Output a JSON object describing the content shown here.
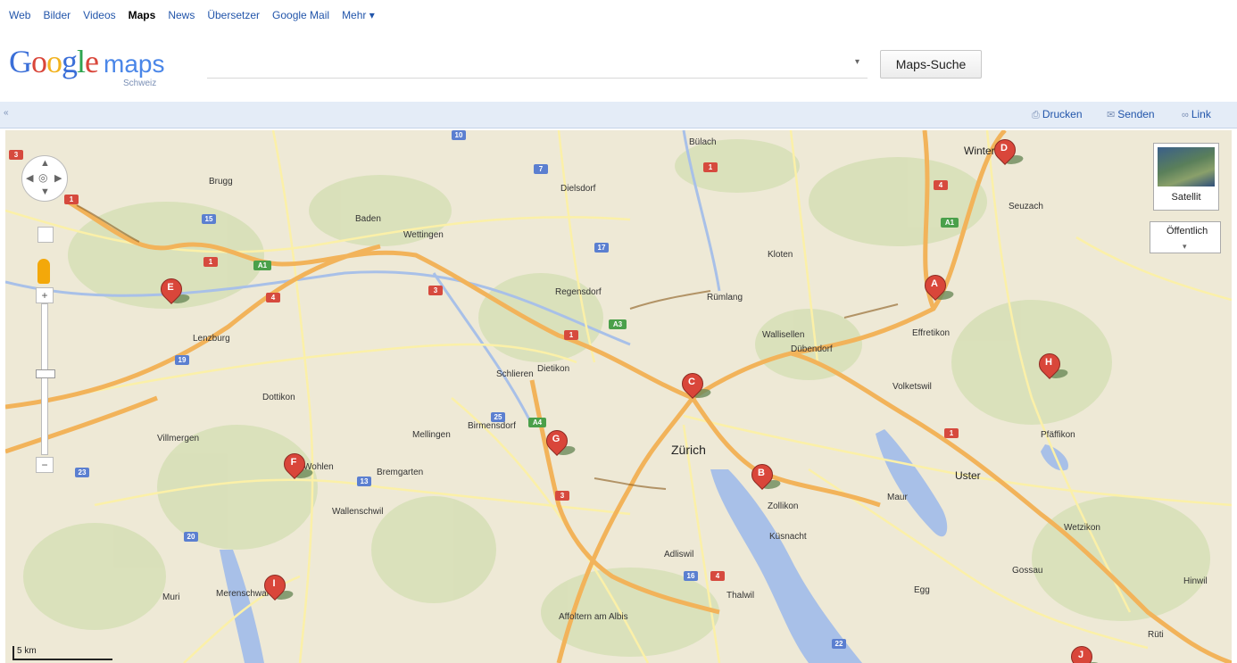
{
  "topnav": {
    "items": [
      "Web",
      "Bilder",
      "Videos",
      "Maps",
      "News",
      "Übersetzer",
      "Google Mail",
      "Mehr ▾"
    ],
    "active_index": 3
  },
  "header": {
    "logo_google": "Google",
    "logo_maps": "maps",
    "logo_country": "Schweiz",
    "search_value": "",
    "dropdown_icon": "▾",
    "search_button": "Maps-Suche"
  },
  "toolbar": {
    "collapse_icon": "«",
    "print": "Drucken",
    "send": "Senden",
    "link": "Link"
  },
  "map": {
    "zoom_in": "+",
    "zoom_out": "−",
    "satellite": "Satellit",
    "public": "Öffentlich",
    "scale_label": "5 km",
    "places": [
      {
        "name": "Zürich",
        "size": "big"
      },
      {
        "name": "Winterthur",
        "size": "mid"
      },
      {
        "name": "Uster",
        "size": "mid"
      },
      {
        "name": "Kloten",
        "size": "small"
      },
      {
        "name": "Wettingen",
        "size": "small"
      },
      {
        "name": "Baden",
        "size": "small"
      },
      {
        "name": "Wohlen",
        "size": "small"
      },
      {
        "name": "Bremgarten",
        "size": "small"
      },
      {
        "name": "Dietikon",
        "size": "small"
      },
      {
        "name": "Zollikon",
        "size": "small"
      },
      {
        "name": "Küsnacht",
        "size": "small"
      },
      {
        "name": "Adliswil",
        "size": "small"
      },
      {
        "name": "Wallisellen",
        "size": "small"
      },
      {
        "name": "Dübendorf",
        "size": "small"
      },
      {
        "name": "Volketswil",
        "size": "small"
      },
      {
        "name": "Wetzikon",
        "size": "small"
      },
      {
        "name": "Egg",
        "size": "small"
      },
      {
        "name": "Thalwil",
        "size": "small"
      },
      {
        "name": "Affoltern am Albis",
        "size": "small"
      },
      {
        "name": "Mellingen",
        "size": "small"
      },
      {
        "name": "Lenzburg",
        "size": "small"
      },
      {
        "name": "Brugg",
        "size": "small"
      },
      {
        "name": "Regensdorf",
        "size": "small"
      },
      {
        "name": "Dielsdorf",
        "size": "small"
      },
      {
        "name": "Bülach",
        "size": "small"
      },
      {
        "name": "Rümlang",
        "size": "small"
      },
      {
        "name": "Birmensdorf",
        "size": "small"
      },
      {
        "name": "Schlieren",
        "size": "small"
      },
      {
        "name": "Pfäffikon",
        "size": "small"
      },
      {
        "name": "Effretikon",
        "size": "small"
      },
      {
        "name": "Seuzach",
        "size": "small"
      },
      {
        "name": "Muri",
        "size": "small"
      },
      {
        "name": "Wallenschwil",
        "size": "small"
      },
      {
        "name": "Dottikon",
        "size": "small"
      },
      {
        "name": "Villmergen",
        "size": "small"
      },
      {
        "name": "Merenschwand",
        "size": "small"
      },
      {
        "name": "Maur",
        "size": "small"
      },
      {
        "name": "Gossau",
        "size": "small"
      },
      {
        "name": "Hinwil",
        "size": "small"
      },
      {
        "name": "Rüti",
        "size": "small"
      }
    ],
    "markers": [
      "A",
      "B",
      "C",
      "D",
      "E",
      "F",
      "G",
      "H",
      "I",
      "J"
    ],
    "shields_red": [
      "3",
      "1",
      "1",
      "4",
      "3",
      "1",
      "1",
      "4",
      "1",
      "3",
      "4"
    ],
    "shields_blue": [
      "10",
      "7",
      "17",
      "15",
      "19",
      "25",
      "23",
      "13",
      "20",
      "16",
      "22"
    ],
    "shields_green": [
      "A1",
      "A3",
      "A4",
      "A1"
    ]
  }
}
